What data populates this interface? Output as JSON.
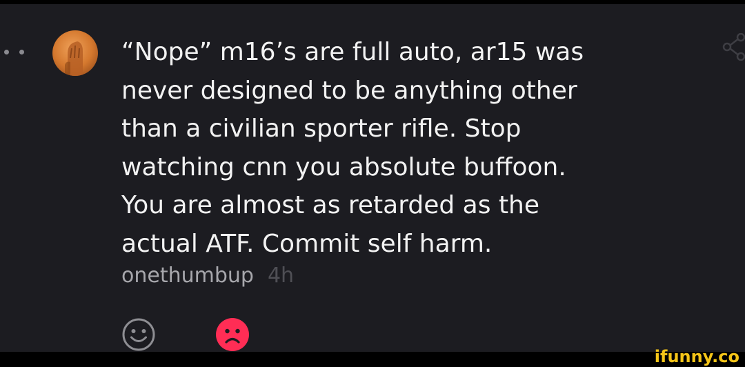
{
  "comment": {
    "text": "“Nope” m16’s are full auto, ar15 was\nnever designed to be anything other\nthan a civilian sporter rifle. Stop\nwatching cnn you absolute buffoon.\nYou are almost as retarded as the\nactual ATF. Commit self harm.",
    "username": "onethumbup",
    "time": "4h"
  },
  "reactions": [
    {
      "icon": "smiley-face-icon",
      "color": "#8e8e93"
    },
    {
      "icon": "sad-face-icon",
      "color": "#ff2d55"
    }
  ],
  "watermark": "ifunny.co",
  "colors": {
    "background": "#1c1c21",
    "text": "#f2f2f2",
    "username": "#a7a7ac",
    "time": "#4f4f55",
    "accent": "#ff2d55",
    "watermark": "#f5c518"
  }
}
